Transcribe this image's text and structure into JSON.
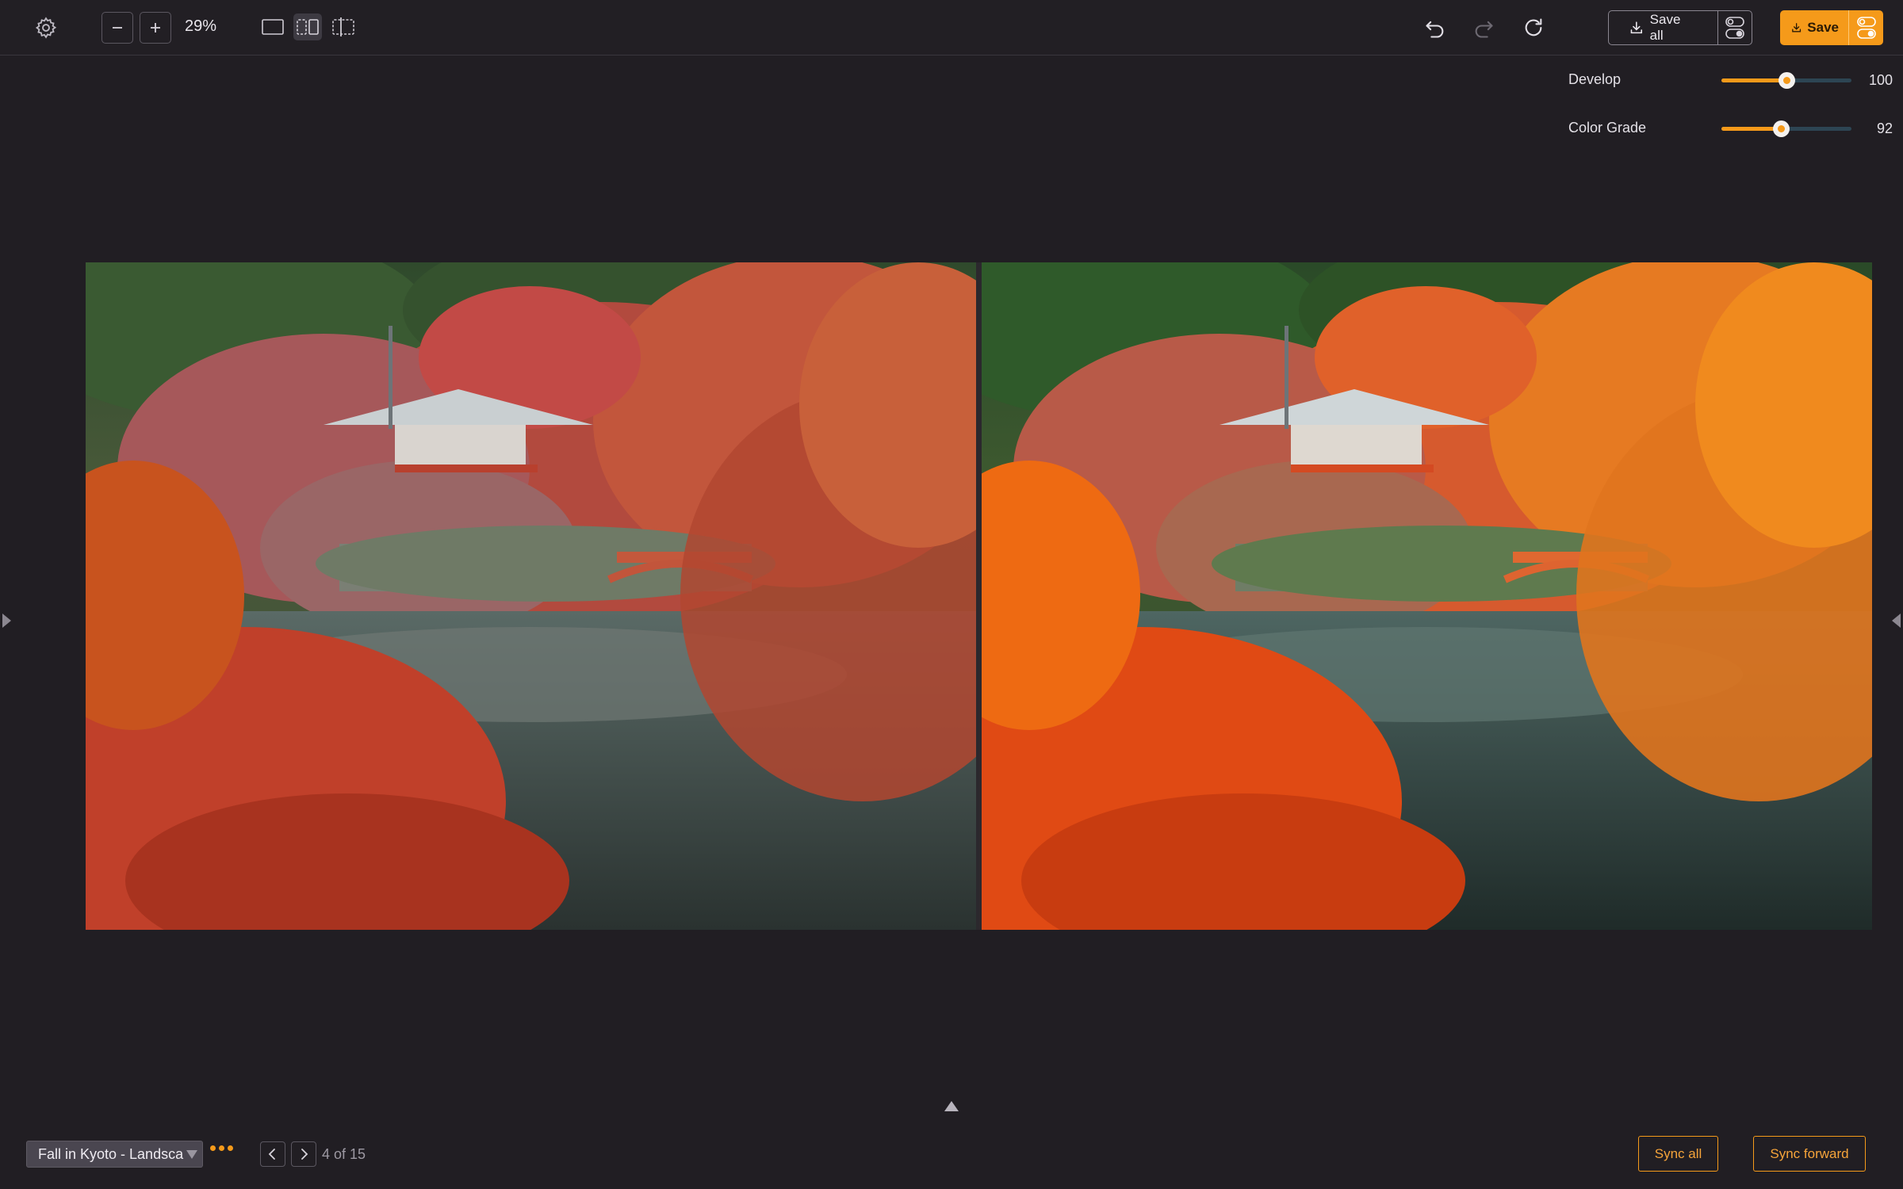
{
  "toolbar": {
    "zoom_label": "29%",
    "icons": [
      "gear-icon",
      "zoom-out-icon",
      "zoom-in-icon",
      "single-view-icon",
      "split-view-icon",
      "slider-view-icon",
      "undo-icon",
      "redo-icon",
      "reset-icon",
      "download-icon",
      "toggle-icon"
    ],
    "save_all_label": "Save all",
    "save_label": "Save",
    "accent": "#f59a1a"
  },
  "sliders": [
    {
      "label": "Develop",
      "value": "100",
      "level": 0.5
    },
    {
      "label": "Color Grade",
      "value": "92",
      "level": 0.46
    }
  ],
  "footer": {
    "preset_name": "Fall in Kyoto - Landsca",
    "counter": "4 of 15",
    "sync_all_label": "Sync all",
    "sync_forward_label": "Sync forward"
  }
}
